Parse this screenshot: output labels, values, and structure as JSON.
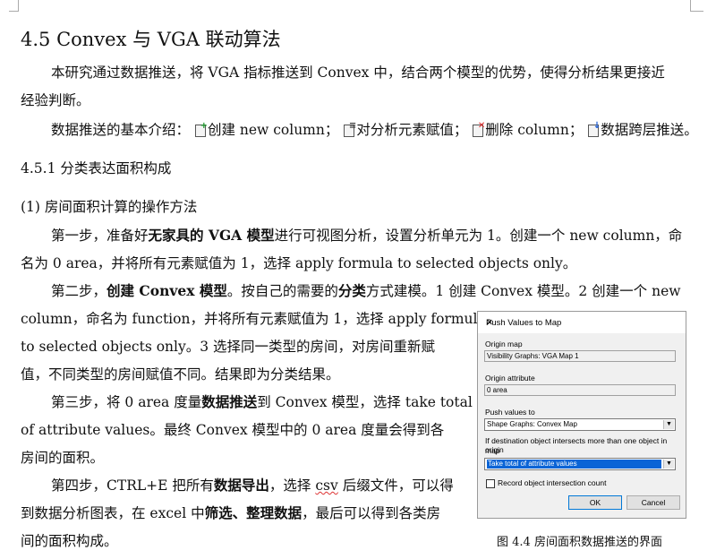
{
  "heading": "4.5 Convex 与 VGA 联动算法",
  "intro_1": "本研究通过数据推送，将 VGA 指标推送到 Convex 中，结合两个模型的优势，使得分析结果更接近",
  "intro_2": "经验判断。",
  "basic_prefix": "数据推送的基本介绍：",
  "basic_item1": "创建 new column；",
  "basic_item2": "对分析元素赋值；",
  "basic_item3": "删除 column；",
  "basic_item4": "数据跨层推送。",
  "section": "4.5.1 分类表达面积构成",
  "subsection": "(1) 房间面积计算的操作方法",
  "step1_a": "第一步，准备好",
  "step1_b": "无家具的 VGA 模型",
  "step1_c": "进行可视图分析，设置分析单元为 1。创建一个 new column，命",
  "step1_line2": "名为 0 area，并将所有元素赋值为 1，选择 apply formula to selected objects only。",
  "step2_a": "第二步，",
  "step2_b": "创建 Convex 模型",
  "step2_c": "。按自己的需要的",
  "step2_d": "分类",
  "step2_e": "方式建模。1 创建 Convex 模型。2 创建一个 new",
  "step2_line2": "column，命名为 function，并将所有元素赋值为 1，选择 apply formula",
  "step2_line3": "to selected objects only。3 选择同一类型的房间，对房间重新赋",
  "step2_line4": "值，不同类型的房间赋值不同。结果即为分类结果。",
  "step3_a": "第三步，将 0 area 度量",
  "step3_b": "数据推送",
  "step3_c": "到 Convex 模型，选择 take total",
  "step3_line2": "of attribute values。最终 Convex 模型中的 0 area 度量会得到各",
  "step3_line3": "房间的面积。",
  "step4_a": "第四步，CTRL+E 把所有",
  "step4_b": "数据导出",
  "step4_c": "，选择 ",
  "step4_d": "csv",
  "step4_e": " 后缀文件，可以得",
  "step4_line2_a": "到数据分析图表，在 excel 中",
  "step4_line2_b": "筛选、整理数据",
  "step4_line2_c": "，最后可以得到各类房",
  "step4_line3": "间的面积构成。",
  "dialog": {
    "title": "Push Values to Map",
    "close": "✕",
    "origin_map_label": "Origin map",
    "origin_map_value": "Visibility Graphs: VGA Map 1",
    "origin_attr_label": "Origin attribute",
    "origin_attr_value": "0 area",
    "push_to_label": "Push values to",
    "push_to_value": "Shape Graphs: Convex Map",
    "intersect_label_1": "If destination object intersects more than one object in origin",
    "intersect_label_2": "map",
    "intersect_value": "Take total of attribute values",
    "record_label": "Record object intersection count",
    "ok": "OK",
    "cancel": "Cancel"
  },
  "caption": "图 4.4 房间面积数据推送的界面",
  "icons": [
    "new-column-icon",
    "edit-values-icon",
    "delete-column-icon",
    "push-values-icon"
  ]
}
